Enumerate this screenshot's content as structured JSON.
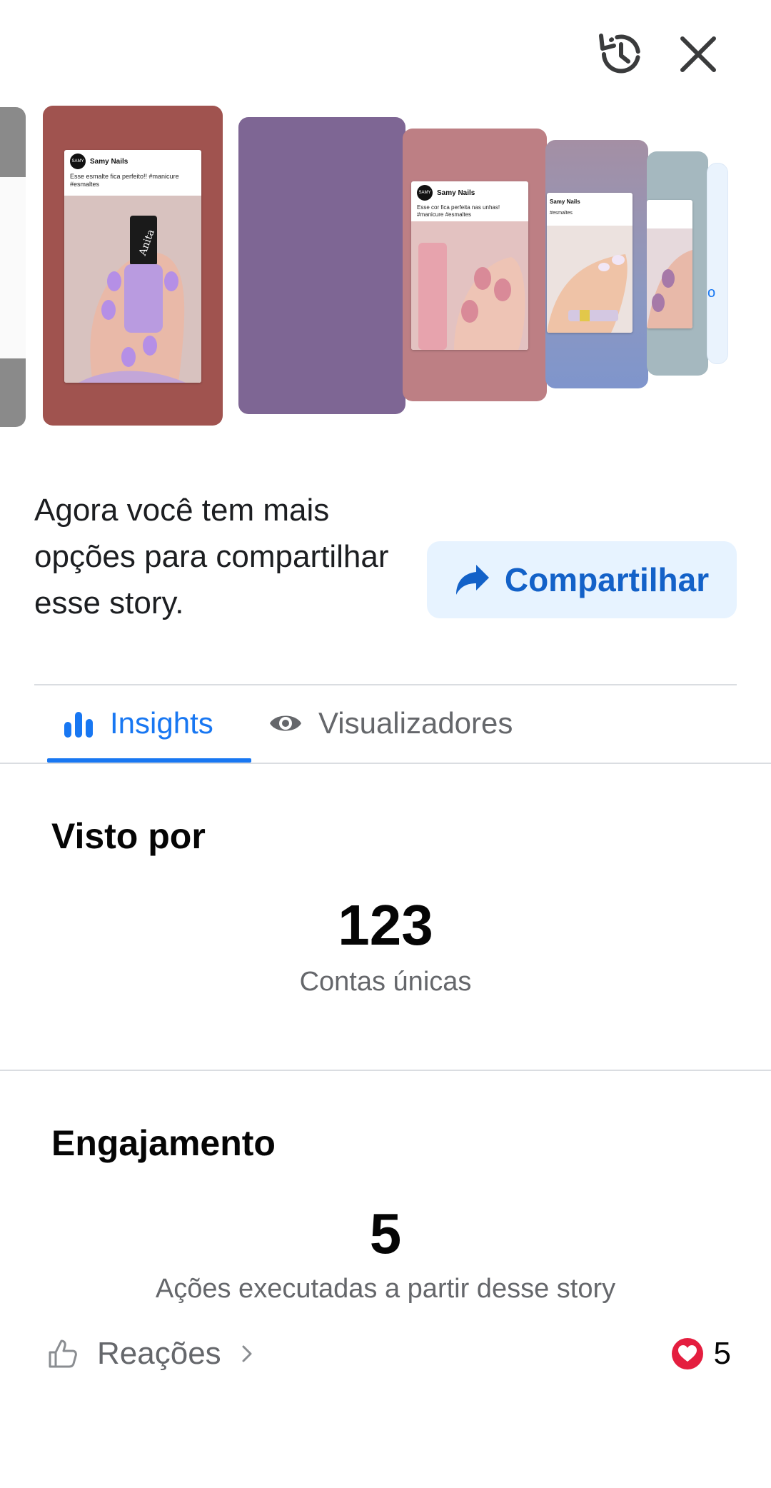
{
  "header": {
    "history_icon": "history-icon",
    "close_icon": "close-icon"
  },
  "stories": [
    {
      "user": "Samy Nails",
      "caption": "Esse esmalte fica perfeito!! #manicure #esmaltes",
      "avatar_text": "SAMY",
      "bg_color": "#a0534f"
    },
    {
      "bg_color": "#7e6694"
    },
    {
      "user": "Samy Nails",
      "caption": "Esse cor fica perfeita nas unhas! #manicure #esmaltes",
      "avatar_text": "SAMY",
      "bg_color": "#bd7f84"
    },
    {
      "user": "Samy Nails",
      "caption": "#esmaltes",
      "bg_color": "#8d98c0"
    },
    {
      "bg_color": "#a5b8bf"
    },
    {
      "letter": "o",
      "bg_color": "#eaf3fd"
    }
  ],
  "share": {
    "text": "Agora você tem mais opções para compartilhar esse story.",
    "button_label": "Compartilhar",
    "accent": "#1361c8",
    "button_bg": "#e7f3ff"
  },
  "tabs": [
    {
      "label": "Insights",
      "icon": "bar-chart-icon",
      "active": true
    },
    {
      "label": "Visualizadores",
      "icon": "eye-icon",
      "active": false
    }
  ],
  "seen_by": {
    "title": "Visto por",
    "value": "123",
    "label": "Contas únicas"
  },
  "engagement": {
    "title": "Engajamento",
    "value": "5",
    "label": "Ações executadas a partir desse story",
    "reactions_label": "Reações",
    "reactions_count": "5",
    "reaction_icon": "heart-icon",
    "reaction_color": "#e41e3f"
  },
  "colors": {
    "primary": "#1877f2",
    "secondary_text": "#65676b",
    "divider": "#dadde1"
  }
}
